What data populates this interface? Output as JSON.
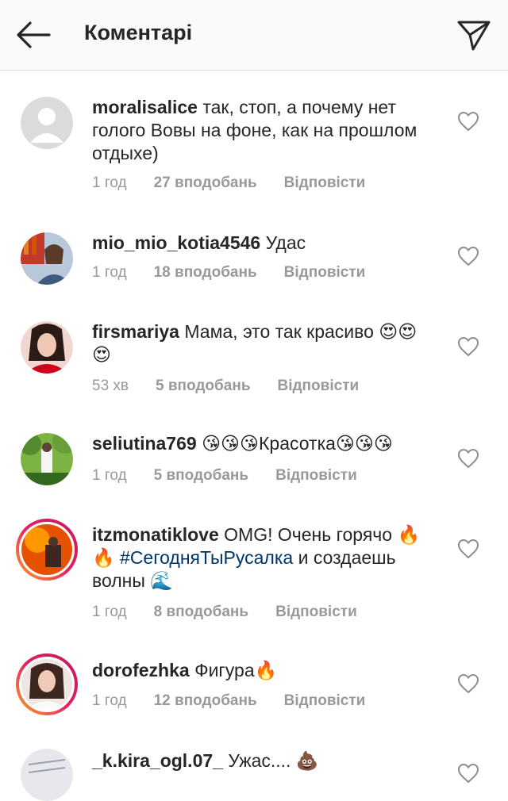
{
  "header": {
    "title": "Коментарі",
    "back_icon": "back-arrow-icon",
    "send_icon": "paper-plane-icon"
  },
  "comments": [
    {
      "username": "moralisalice",
      "text": "так, стоп, а почему нет голого Вовы на фоне, как на прошлом отдыхе)",
      "time": "1 год",
      "likes": "27 вподобань",
      "reply": "Відповісти"
    },
    {
      "username": "mio_mio_kotia4546",
      "text": "Удас",
      "time": "1 год",
      "likes": "18 вподобань",
      "reply": "Відповісти"
    },
    {
      "username": "firsmariya",
      "text": "Мама, это так красиво 😍😍😍",
      "time": "53 хв",
      "likes": "5 вподобань",
      "reply": "Відповісти"
    },
    {
      "username": "seliutina769",
      "text": "😘😘😘Красотка😘😘😘",
      "time": "1 год",
      "likes": "5 вподобань",
      "reply": "Відповісти"
    },
    {
      "username": "itzmonatiklove",
      "text_before": "OMG! Очень горячо 🔥🔥 ",
      "hashtag": "#СегодняТыРусалка",
      "text_after": " и создаешь волны 🌊",
      "time": "1 год",
      "likes": "8 вподобань",
      "reply": "Відповісти"
    },
    {
      "username": "dorofezhka",
      "text": "Фигура🔥",
      "time": "1 год",
      "likes": "12 вподобань",
      "reply": "Відповісти"
    },
    {
      "username": "_k.kira_ogl.07_",
      "text": "Ужас.... 💩"
    }
  ],
  "colors": {
    "header_bg": "#fafafa",
    "text": "#262626",
    "meta": "#999999",
    "hashtag": "#003569"
  }
}
